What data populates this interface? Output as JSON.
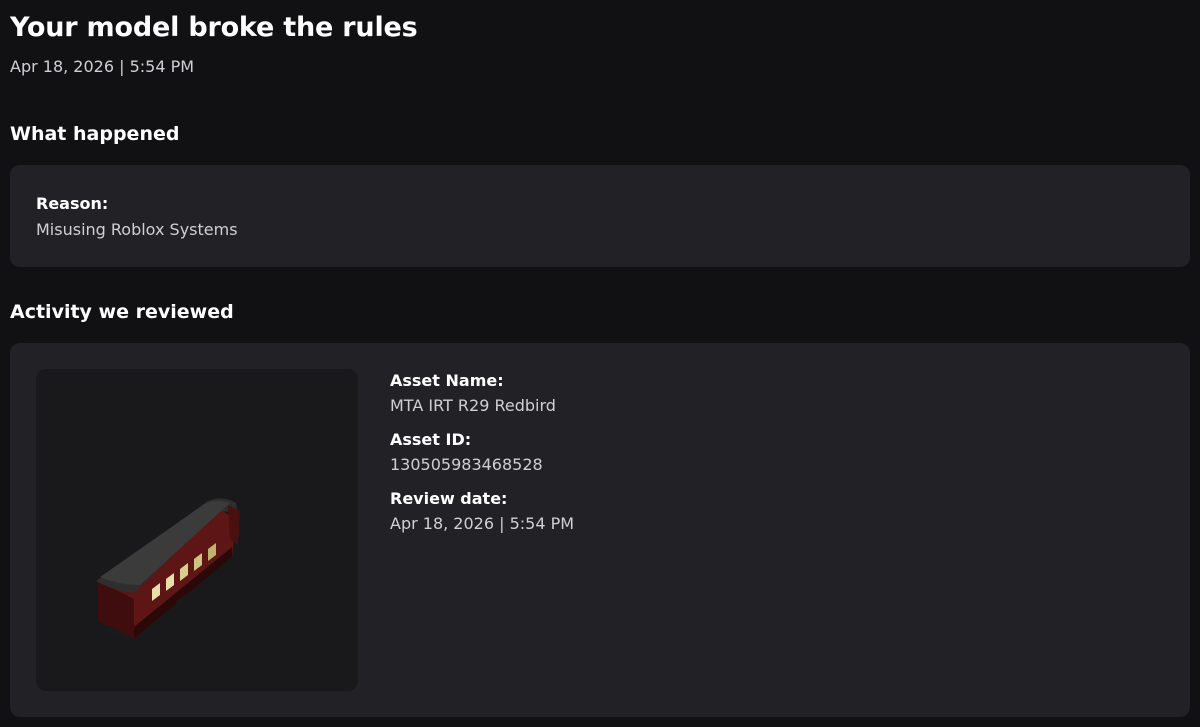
{
  "header": {
    "title": "Your model broke the rules",
    "timestamp": "Apr 18, 2026 | 5:54 PM"
  },
  "what_happened": {
    "heading": "What happened",
    "reason_label": "Reason:",
    "reason_value": "Misusing Roblox Systems"
  },
  "activity": {
    "heading": "Activity we reviewed",
    "thumbnail_icon": "train-car-model-thumbnail",
    "asset_name_label": "Asset Name:",
    "asset_name_value": "MTA IRT R29 Redbird",
    "asset_id_label": "Asset ID:",
    "asset_id_value": "130505983468528",
    "review_date_label": "Review date:",
    "review_date_value": "Apr 18, 2026 | 5:54 PM"
  },
  "colors": {
    "background": "#111113",
    "card": "#222226",
    "thumbnail_bg": "#19191c",
    "train_body": "#5a1414",
    "train_roof": "#2a2a2a"
  }
}
